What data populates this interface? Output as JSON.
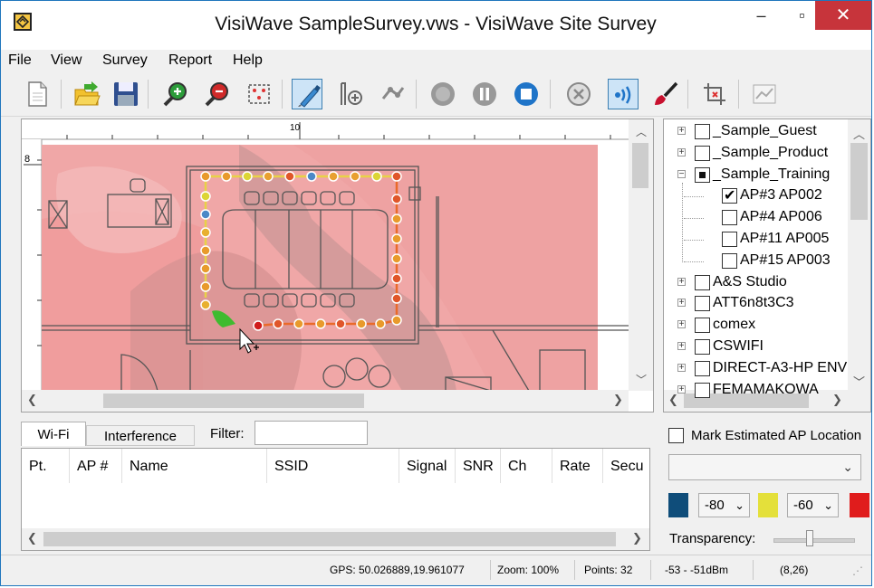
{
  "window": {
    "title": "VisiWave SampleSurvey.vws - VisiWave Site Survey",
    "minimize": "‒",
    "maximize": "▫",
    "close": "✕"
  },
  "menu": [
    "File",
    "View",
    "Survey",
    "Report",
    "Help"
  ],
  "toolbar_icons": [
    "new-document-icon",
    "open-folder-icon",
    "save-disk-icon",
    "zoom-in-icon",
    "zoom-out-icon",
    "zoom-fit-icon",
    "survey-pen-icon",
    "add-floor-icon",
    "walk-icon",
    "record-icon",
    "pause-icon",
    "stop-icon",
    "cancel-icon",
    "wifi-scan-icon",
    "brush-icon",
    "crop-icon",
    "report-icon"
  ],
  "ruler": {
    "top_label": "10",
    "left_label": "8"
  },
  "bottom": {
    "tabs": [
      "Wi-Fi",
      "Interference"
    ],
    "filter_label": "Filter:",
    "filter_value": "",
    "columns": [
      "Pt.",
      "AP #",
      "Name",
      "SSID",
      "Signal",
      "SNR",
      "Ch",
      "Rate",
      "Secu"
    ]
  },
  "tree": {
    "items": [
      {
        "label": "_Sample_Guest",
        "level": 0,
        "expander": "+",
        "state": "unchecked"
      },
      {
        "label": "_Sample_Product",
        "level": 0,
        "expander": "+",
        "state": "unchecked"
      },
      {
        "label": "_Sample_Training",
        "level": 0,
        "expander": "−",
        "state": "partial"
      },
      {
        "label": "AP#3 AP002",
        "level": 1,
        "expander": "",
        "state": "checked"
      },
      {
        "label": "AP#4 AP006",
        "level": 1,
        "expander": "",
        "state": "unchecked"
      },
      {
        "label": "AP#11 AP005",
        "level": 1,
        "expander": "",
        "state": "unchecked"
      },
      {
        "label": "AP#15 AP003",
        "level": 1,
        "expander": "",
        "state": "unchecked"
      },
      {
        "label": "A&S Studio",
        "level": 0,
        "expander": "+",
        "state": "unchecked"
      },
      {
        "label": "ATT6n8t3C3",
        "level": 0,
        "expander": "+",
        "state": "unchecked"
      },
      {
        "label": "comex",
        "level": 0,
        "expander": "+",
        "state": "unchecked"
      },
      {
        "label": "CSWIFI",
        "level": 0,
        "expander": "+",
        "state": "unchecked"
      },
      {
        "label": "DIRECT-A3-HP ENV",
        "level": 0,
        "expander": "+",
        "state": "unchecked"
      },
      {
        "label": "FEMAMAKOWA",
        "level": 0,
        "expander": "+",
        "state": "unchecked"
      }
    ]
  },
  "legend": {
    "mark_label": "Mark Estimated AP Location",
    "combo_value": "",
    "low_color": "#0f4d7a",
    "mid_color": "#e4e03a",
    "high_color": "#e01c1c",
    "low_value": "-80",
    "high_value": "-60",
    "transparency_label": "Transparency:",
    "transparency_level": 0.45
  },
  "status": {
    "gps": "GPS: 50.026889,19.961077",
    "zoom": "Zoom: 100%",
    "points": "Points: 32",
    "range": "-53 - -51dBm",
    "coords": "(8,26)"
  }
}
